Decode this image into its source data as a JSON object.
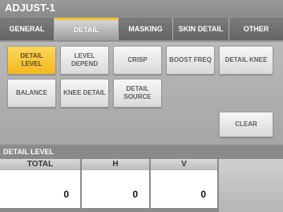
{
  "window": {
    "title": "ADJUST-1"
  },
  "tabs": [
    {
      "label": "GENERAL"
    },
    {
      "label": "DETAIL",
      "active": true
    },
    {
      "label": "MASKING"
    },
    {
      "label": "SKIN DETAIL"
    },
    {
      "label": "OTHER"
    }
  ],
  "buttons": {
    "detail_level": "DETAIL LEVEL",
    "level_depend": "LEVEL DEPEND",
    "crisp": "CRISP",
    "boost_freq": "BOOST FREQ",
    "detail_knee": "DETAIL KNEE",
    "balance": "BALANCE",
    "knee_detail": "KNEE DETAIL",
    "detail_source": "DETAIL SOURCE",
    "clear": "CLEAR"
  },
  "panel": {
    "title": "DETAIL LEVEL",
    "columns": [
      {
        "label": "TOTAL",
        "value": "0"
      },
      {
        "label": "H",
        "value": "0"
      },
      {
        "label": "V",
        "value": "0"
      }
    ]
  },
  "colors": {
    "active_accent": "#f2c232",
    "background": "#8e8e8e"
  }
}
